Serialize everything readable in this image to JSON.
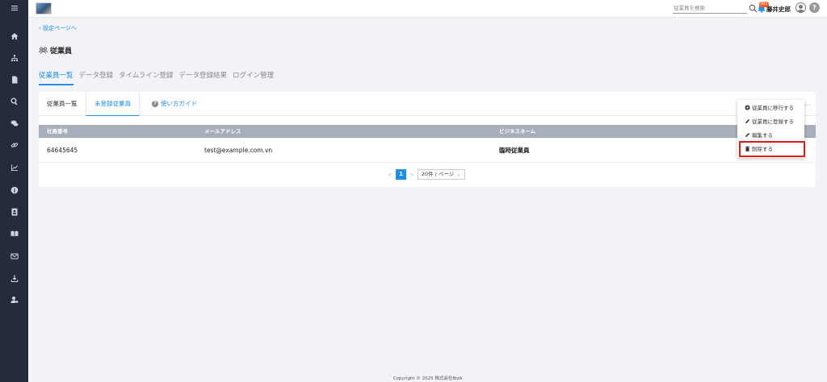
{
  "sidebar": {
    "icons": [
      "menu-icon",
      "home-icon",
      "org-chart-icon",
      "document-icon",
      "search-icon",
      "chat-icon",
      "link-icon",
      "chart-icon",
      "info-icon",
      "contact-icon",
      "book-icon",
      "mail-icon",
      "download-icon",
      "user-settings-icon"
    ]
  },
  "header": {
    "search_placeholder": "従業員を検索",
    "notification_count": "381",
    "user_name": "藤井史郎",
    "help_label": "?"
  },
  "back_link": "設定ページへ",
  "page_title": "従業員",
  "tabs": [
    {
      "label": "従業員一覧",
      "active": true
    },
    {
      "label": "データ登録",
      "active": false
    },
    {
      "label": "タイムライン登録",
      "active": false
    },
    {
      "label": "データ登録結果",
      "active": false
    },
    {
      "label": "ログイン管理",
      "active": false
    }
  ],
  "subtabs": {
    "all": "従業員一覧",
    "unregistered": "未登録従業員",
    "guide": "使い方ガイド"
  },
  "table": {
    "headers": [
      "社員番号",
      "メールアドレス",
      "ビジネスネーム"
    ],
    "rows": [
      {
        "id": "64645645",
        "email": "test@example.com.vn",
        "business_name": "臨時従業員"
      }
    ]
  },
  "pagination": {
    "prev": "<",
    "current": "1",
    "next": ">",
    "page_size": "20件 / ページ"
  },
  "action_menu": {
    "items": [
      "従業員に移行する",
      "従業員に登録する",
      "編集する",
      "削除する"
    ],
    "more": "..."
  },
  "footer": "Copyright © 2025 株式会社BizA",
  "colors": {
    "accent": "#1f8fe6",
    "sidebar": "#262a3d",
    "highlight": "#e01818"
  }
}
